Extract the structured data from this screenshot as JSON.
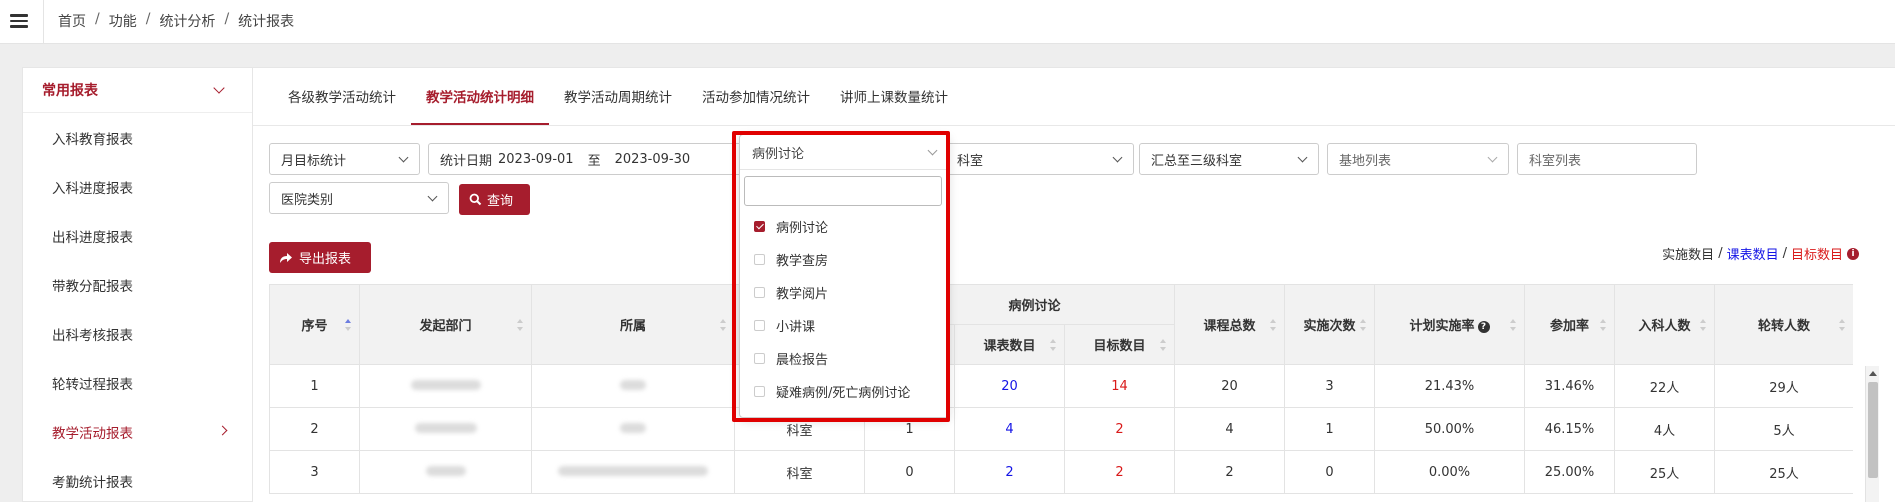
{
  "breadcrumb": [
    "首页",
    "功能",
    "统计分析",
    "统计报表"
  ],
  "breadcrumb_sep": "/",
  "sidebar": {
    "header": "常用报表",
    "items": [
      {
        "label": "入科教育报表"
      },
      {
        "label": "入科进度报表"
      },
      {
        "label": "出科进度报表"
      },
      {
        "label": "带教分配报表"
      },
      {
        "label": "出科考核报表"
      },
      {
        "label": "轮转过程报表"
      },
      {
        "label": "教学活动报表",
        "active": true
      },
      {
        "label": "考勤统计报表"
      }
    ]
  },
  "tabs": [
    {
      "label": "各级教学活动统计"
    },
    {
      "label": "教学活动统计明细",
      "active": true
    },
    {
      "label": "教学活动周期统计"
    },
    {
      "label": "活动参加情况统计"
    },
    {
      "label": "讲师上课数量统计"
    }
  ],
  "filters": {
    "stat_type": "月目标统计",
    "date_label": "统计日期",
    "date_from": "2023-09-01",
    "date_to_sep": "至",
    "date_to": "2023-09-30",
    "activity_type": "病例讨论",
    "dept": "科室",
    "summary": "汇总至三级科室",
    "base_list": "基地列表",
    "dept_list": "科室列表",
    "hospital_type": "医院类别",
    "query_label": "查询",
    "export_label": "导出报表"
  },
  "legend": {
    "a": "实施数目",
    "sep1": "/",
    "b": "课表数目",
    "sep2": "/",
    "c": "目标数目"
  },
  "colors": {
    "brand": "#a61d2d",
    "blue": "#1515e6",
    "red": "#d91a1a",
    "highlight": "#e00000"
  },
  "table": {
    "headers": {
      "seq": "序号",
      "dept": "发起部门",
      "belong": "所属",
      "group": "病例讨论",
      "sched": "课表数目",
      "target": "目标数目",
      "total": "课程总数",
      "count": "实施次数",
      "rate": "计划实施率",
      "join": "参加率",
      "enter": "入科人数",
      "rotate": "轮转人数"
    },
    "rows": [
      {
        "seq": "1",
        "type": "",
        "impl": "",
        "sched": "20",
        "target": "14",
        "total": "20",
        "count": "3",
        "rate": "21.43%",
        "join": "31.46%",
        "enter": "22人",
        "rotate": "29人"
      },
      {
        "seq": "2",
        "type": "科室",
        "impl": "1",
        "sched": "4",
        "target": "2",
        "total": "4",
        "count": "1",
        "rate": "50.00%",
        "join": "46.15%",
        "enter": "4人",
        "rotate": "5人"
      },
      {
        "seq": "3",
        "type": "科室",
        "impl": "0",
        "sched": "2",
        "target": "2",
        "total": "2",
        "count": "0",
        "rate": "0.00%",
        "join": "25.00%",
        "enter": "25人",
        "rotate": "25人"
      }
    ]
  },
  "dropdown": {
    "selected": "病例讨论",
    "search_value": "",
    "options": [
      {
        "label": "病例讨论",
        "checked": true
      },
      {
        "label": "教学查房",
        "checked": false
      },
      {
        "label": "教学阅片",
        "checked": false
      },
      {
        "label": "小讲课",
        "checked": false
      },
      {
        "label": "晨检报告",
        "checked": false
      },
      {
        "label": "疑难病例/死亡病例讨论",
        "checked": false
      }
    ]
  }
}
